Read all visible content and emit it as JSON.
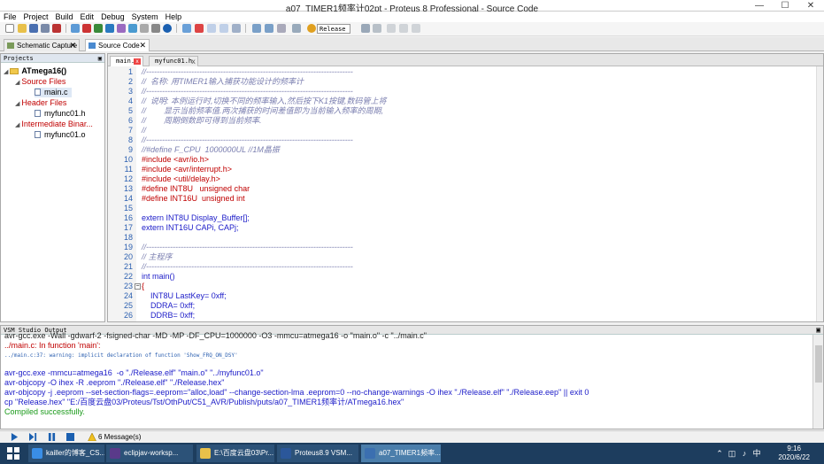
{
  "window": {
    "title": "a07_TIMER1频率计02pt - Proteus 8 Professional - Source Code",
    "minimize": "—",
    "maximize": "☐",
    "close": "✕"
  },
  "menu": [
    "File",
    "Project",
    "Build",
    "Edit",
    "Debug",
    "System",
    "Help"
  ],
  "toolbar": {
    "build_config": "Release"
  },
  "page_tabs": [
    {
      "label": "Schematic Capture",
      "close": "✕"
    },
    {
      "label": "Source Code",
      "close": "✕"
    }
  ],
  "projects": {
    "header": "Projects",
    "pin": "▣",
    "root": "ATmega16()",
    "source_folder": "Source Files",
    "source_file": "main.c",
    "header_folder": "Header Files",
    "header_file": "myfunc01.h",
    "intermediate_folder": "Intermediate Binar...",
    "intermediate_file": "myfunc01.o"
  },
  "editor": {
    "tabs": [
      {
        "label": "main.c",
        "close": "x"
      },
      {
        "label": "myfunc01.h",
        "close": "x"
      }
    ],
    "lines": [
      {
        "n": "1",
        "t": "//------------------------------------------------------------------------------",
        "k": "com"
      },
      {
        "n": "2",
        "t": "//  名称: 用TIMER1输入捕获功能设计的频率计",
        "k": "com"
      },
      {
        "n": "3",
        "t": "//------------------------------------------------------------------------------",
        "k": "com"
      },
      {
        "n": "4",
        "t": "//  说明: 本例运行时,切换不同的频率输入,然后按下K1按键,数码管上将",
        "k": "com"
      },
      {
        "n": "5",
        "t": "//        显示当前频率值.两次捕获的时间差值即为当前输入频率的周期,",
        "k": "com"
      },
      {
        "n": "6",
        "t": "//        周期倒数即可得到当前频率.",
        "k": "com"
      },
      {
        "n": "7",
        "t": "//",
        "k": "com"
      },
      {
        "n": "8",
        "t": "//------------------------------------------------------------------------------",
        "k": "com"
      },
      {
        "n": "9",
        "t": "//#define F_CPU  1000000UL //1M晶振",
        "k": "com"
      },
      {
        "n": "10",
        "t": "#include <avr/io.h>",
        "k": "pre"
      },
      {
        "n": "11",
        "t": "#include <avr/interrupt.h>",
        "k": "pre"
      },
      {
        "n": "12",
        "t": "#include <util/delay.h>",
        "k": "pre"
      },
      {
        "n": "13",
        "t": "#define INT8U   unsigned char",
        "k": "pre"
      },
      {
        "n": "14",
        "t": "#define INT16U  unsigned int",
        "k": "pre"
      },
      {
        "n": "15",
        "t": "",
        "k": "pl"
      },
      {
        "n": "16",
        "t": "extern INT8U Display_Buffer[];",
        "k": "pl"
      },
      {
        "n": "17",
        "t": "extern INT16U CAPi, CAPj;",
        "k": "pl"
      },
      {
        "n": "18",
        "t": "",
        "k": "pl"
      },
      {
        "n": "19",
        "t": "//------------------------------------------------------------------------------",
        "k": "com"
      },
      {
        "n": "20",
        "t": "// 主程序",
        "k": "com"
      },
      {
        "n": "21",
        "t": "//------------------------------------------------------------------------------",
        "k": "com"
      },
      {
        "n": "22",
        "t": "int main()",
        "k": "pl"
      },
      {
        "n": "23",
        "t": "{",
        "k": "pre"
      },
      {
        "n": "24",
        "t": "    INT8U LastKey= 0xff;",
        "k": "pl"
      },
      {
        "n": "25",
        "t": "    DDRA= 0xff;",
        "k": "pl"
      },
      {
        "n": "26",
        "t": "    DDRB= 0xff;",
        "k": "pl"
      }
    ]
  },
  "output": {
    "header": "VSM Studio Output",
    "lines": [
      {
        "t": "avr-gcc.exe -Wall -gdwarf-2 -fsigned-char -MD -MP -DF_CPU=1000000 -O3 -mmcu=atmega16 -o \"main.o\" -c \"../main.c\"",
        "c": "#222222",
        "s": "big"
      },
      {
        "t": "../main.c: In function 'main':",
        "c": "#c00000",
        "s": "big"
      },
      {
        "t": "../main.c:37: warning: implicit declaration of function 'Show_FRQ_ON_DSY'",
        "c": "#2b5fb0",
        "s": "small"
      },
      {
        "t": "",
        "c": "#222222",
        "s": "big"
      },
      {
        "t": "avr-gcc.exe -mmcu=atmega16  -o \"./Release.elf\" \"main.o\" \"../myfunc01.o\"",
        "c": "#1b1bc8",
        "s": "big"
      },
      {
        "t": "avr-objcopy -O ihex -R .eeprom \"./Release.elf\" \"./Release.hex\"",
        "c": "#1b1bc8",
        "s": "big"
      },
      {
        "t": "avr-objcopy -j .eeprom --set-section-flags=.eeprom=\"alloc,load\" --change-section-lma .eeprom=0 --no-change-warnings -O ihex \"./Release.elf\" \"./Release.eep\" || exit 0",
        "c": "#1b1bc8",
        "s": "big"
      },
      {
        "t": "cp \"Release.hex\" \"E:/百度云盘03/Proteus/Tst/OthPut/C51_AVR/Publish/puts/a07_TIMER1频率计/ATmega16.hex\"",
        "c": "#1b1bc8",
        "s": "big"
      },
      {
        "t": "Compiled successfully.",
        "c": "#1a9a1a",
        "s": "big"
      }
    ]
  },
  "statusbar": {
    "messages": "6 Message(s)"
  },
  "taskbar": {
    "items": [
      {
        "label": "kailler的博客_CS...",
        "color": "#3a8ee6"
      },
      {
        "label": "eclipjav-worksp...",
        "color": "#5a3a8a"
      },
      {
        "label": "E:\\百度云盘03\\Pr...",
        "color": "#e8c04a"
      },
      {
        "label": "Proteus8.9 VSM...",
        "color": "#2b579a"
      },
      {
        "label": "a07_TIMER1频率...",
        "color": "#3b6fb0"
      }
    ],
    "lang": "中",
    "time": "9:16",
    "date": "2020/6/22"
  }
}
